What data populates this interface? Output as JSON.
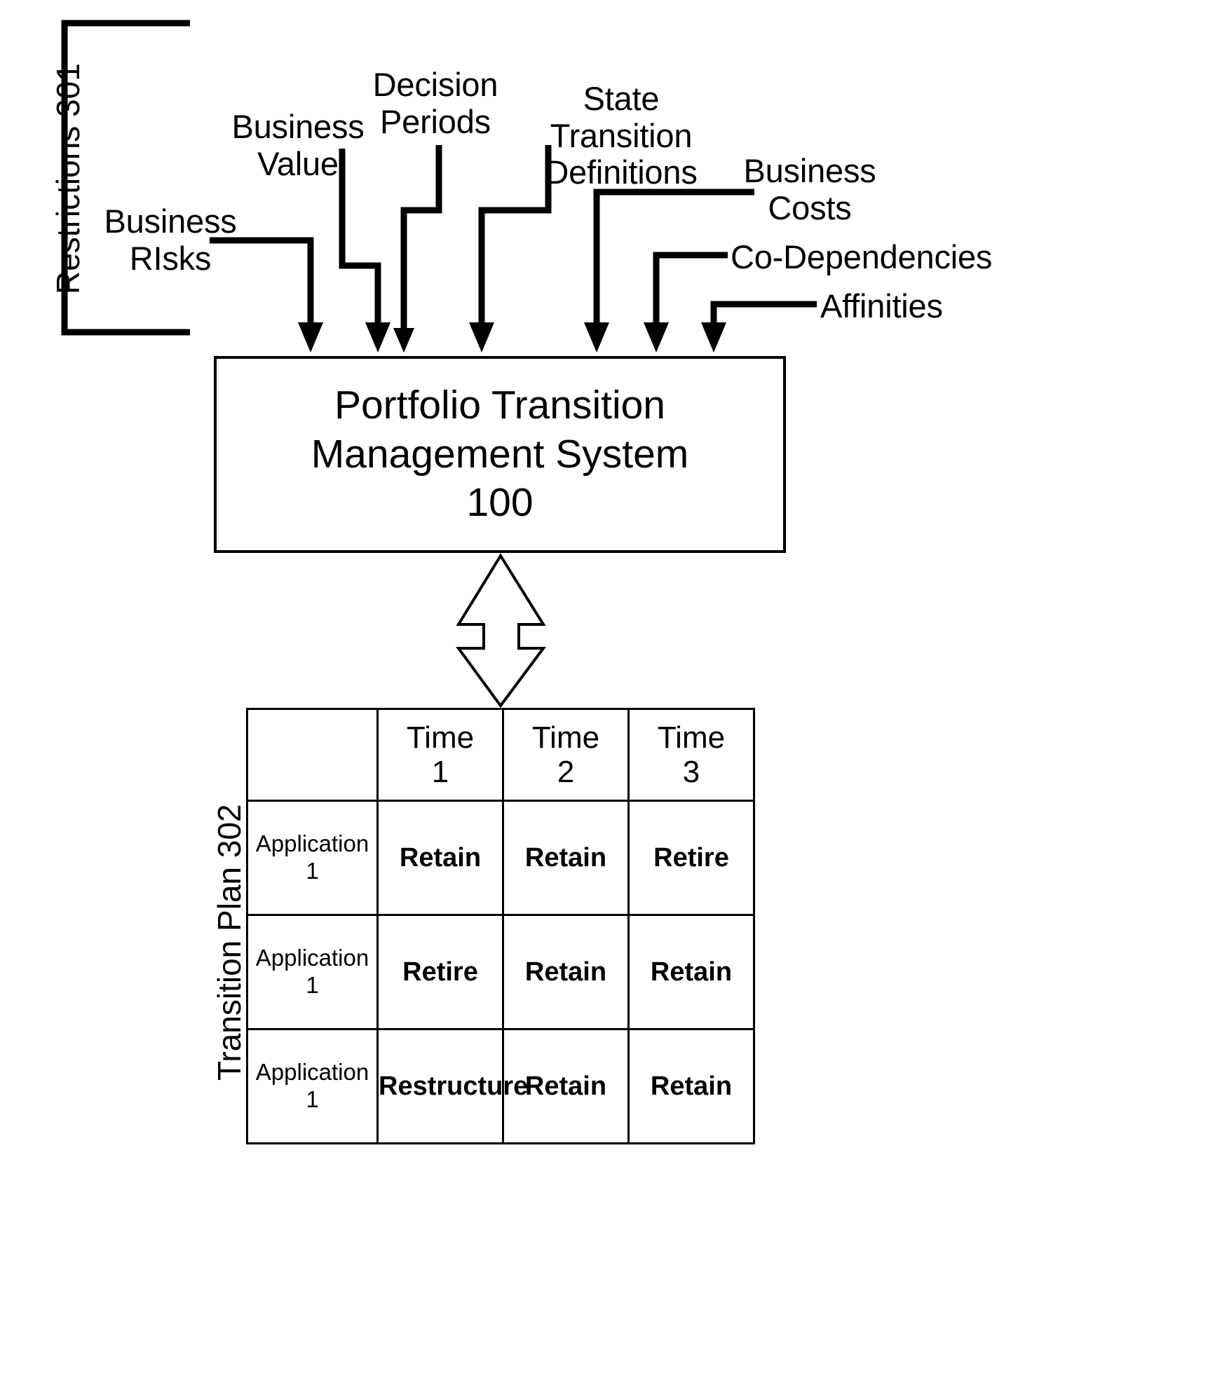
{
  "figure": {
    "restrictions_label": "Restrictions 301",
    "transition_plan_label": "Transition Plan 302"
  },
  "inputs": [
    {
      "id": "business-risks",
      "label": "Business\nRIsks"
    },
    {
      "id": "business-value",
      "label": "Business\nValue"
    },
    {
      "id": "decision-periods",
      "label": "Decision\nPeriods"
    },
    {
      "id": "state-transition-definitions",
      "label": "State Transition\nDefinitions"
    },
    {
      "id": "business-costs",
      "label": "Business\nCosts"
    },
    {
      "id": "co-dependencies",
      "label": "Co-Dependencies"
    },
    {
      "id": "affinities",
      "label": "Affinities"
    }
  ],
  "system_box": {
    "title": "Portfolio Transition\nManagement System\n100"
  },
  "transition_plan": {
    "corner_label": "",
    "columns": [
      "Time\n1",
      "Time\n2",
      "Time\n3"
    ],
    "rows": [
      {
        "app": "Application\n1",
        "cells": [
          "Retain",
          "Retain",
          "Retire"
        ]
      },
      {
        "app": "Application\n1",
        "cells": [
          "Retire",
          "Retain",
          "Retain"
        ]
      },
      {
        "app": "Application\n1",
        "cells": [
          "Restructure",
          "Retain",
          "Retain"
        ]
      }
    ]
  },
  "colors": {
    "stroke": "#000000",
    "background": "#ffffff"
  }
}
